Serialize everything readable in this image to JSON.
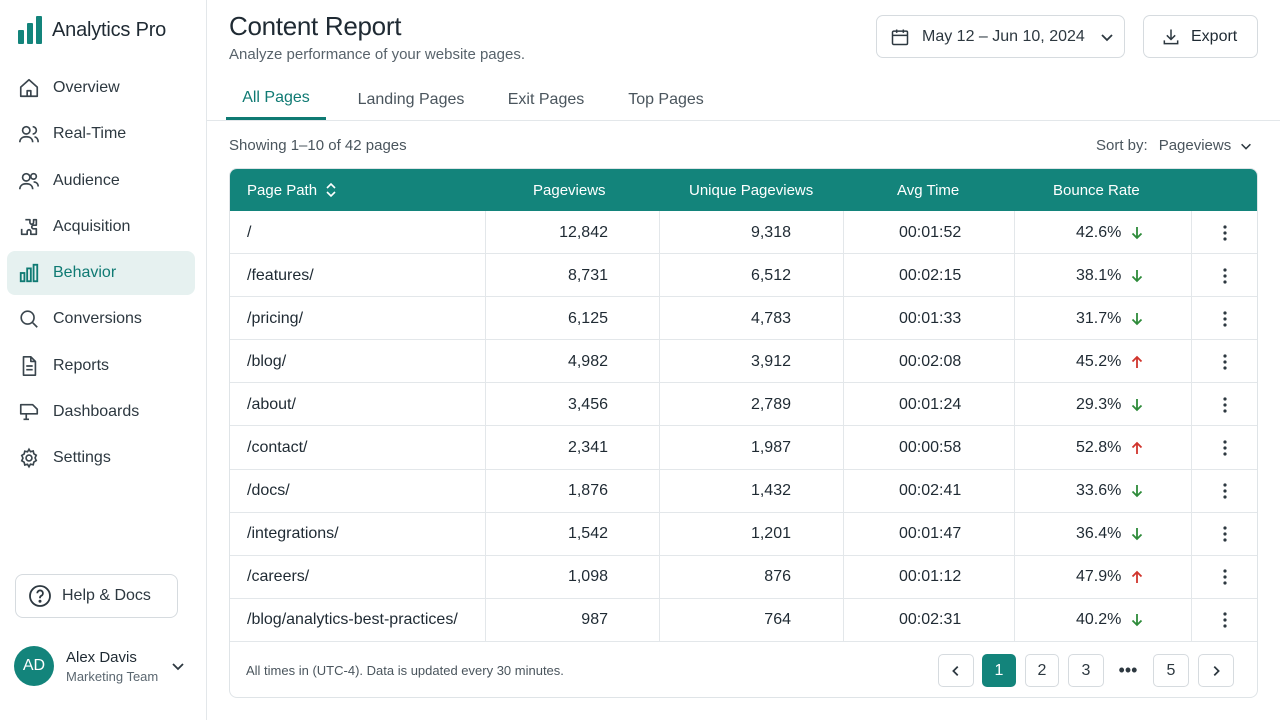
{
  "brand": {
    "name": "Analytics Pro"
  },
  "colors": {
    "accent": "#13847b",
    "down": "#2e8b3a",
    "up": "#d0342c"
  },
  "nav": [
    {
      "label": "Overview",
      "icon": "home-icon"
    },
    {
      "label": "Real-Time",
      "icon": "users-icon"
    },
    {
      "label": "Audience",
      "icon": "audience-icon"
    },
    {
      "label": "Acquisition",
      "icon": "acquisition-icon"
    },
    {
      "label": "Behavior",
      "icon": "bar-chart-icon",
      "active": true
    },
    {
      "label": "Conversions",
      "icon": "search-icon"
    },
    {
      "label": "Reports",
      "icon": "document-icon"
    },
    {
      "label": "Dashboards",
      "icon": "dashboard-icon"
    },
    {
      "label": "Settings",
      "icon": "gear-icon"
    }
  ],
  "help": {
    "label": "Help & Docs"
  },
  "user": {
    "initials": "AD",
    "name": "Alex Davis",
    "team": "Marketing Team"
  },
  "header": {
    "title": "Content Report",
    "subtitle": "Analyze performance of your website pages.",
    "date_range": "May 12 – Jun 10, 2024",
    "export_label": "Export"
  },
  "tabs": [
    {
      "label": "All Pages",
      "active": true
    },
    {
      "label": "Landing Pages"
    },
    {
      "label": "Exit Pages"
    },
    {
      "label": "Top Pages"
    }
  ],
  "list": {
    "showing": "Showing 1–10 of 42 pages",
    "sort_label": "Sort by:",
    "sort_value": "Pageviews"
  },
  "table": {
    "columns": [
      "Page Path",
      "Pageviews",
      "Unique Pageviews",
      "Avg Time",
      "Bounce Rate"
    ],
    "rows": [
      {
        "path": "/",
        "pageviews": "12,842",
        "unique": "9,318",
        "avg_time": "00:01:52",
        "bounce": "42.6%",
        "trend": "down"
      },
      {
        "path": "/features/",
        "pageviews": "8,731",
        "unique": "6,512",
        "avg_time": "00:02:15",
        "bounce": "38.1%",
        "trend": "down"
      },
      {
        "path": "/pricing/",
        "pageviews": "6,125",
        "unique": "4,783",
        "avg_time": "00:01:33",
        "bounce": "31.7%",
        "trend": "down"
      },
      {
        "path": "/blog/",
        "pageviews": "4,982",
        "unique": "3,912",
        "avg_time": "00:02:08",
        "bounce": "45.2%",
        "trend": "up"
      },
      {
        "path": "/about/",
        "pageviews": "3,456",
        "unique": "2,789",
        "avg_time": "00:01:24",
        "bounce": "29.3%",
        "trend": "down"
      },
      {
        "path": "/contact/",
        "pageviews": "2,341",
        "unique": "1,987",
        "avg_time": "00:00:58",
        "bounce": "52.8%",
        "trend": "up"
      },
      {
        "path": "/docs/",
        "pageviews": "1,876",
        "unique": "1,432",
        "avg_time": "00:02:41",
        "bounce": "33.6%",
        "trend": "down"
      },
      {
        "path": "/integrations/",
        "pageviews": "1,542",
        "unique": "1,201",
        "avg_time": "00:01:47",
        "bounce": "36.4%",
        "trend": "down"
      },
      {
        "path": "/careers/",
        "pageviews": "1,098",
        "unique": "876",
        "avg_time": "00:01:12",
        "bounce": "47.9%",
        "trend": "up"
      },
      {
        "path": "/blog/analytics-best-practices/",
        "pageviews": "987",
        "unique": "764",
        "avg_time": "00:02:31",
        "bounce": "40.2%",
        "trend": "down"
      }
    ]
  },
  "footer": {
    "note": "All times in (UTC-4). Data is updated every 30 minutes."
  },
  "pagination": {
    "pages": [
      "1",
      "2",
      "3",
      "5"
    ],
    "ellipsis": "•••",
    "current": "1"
  }
}
